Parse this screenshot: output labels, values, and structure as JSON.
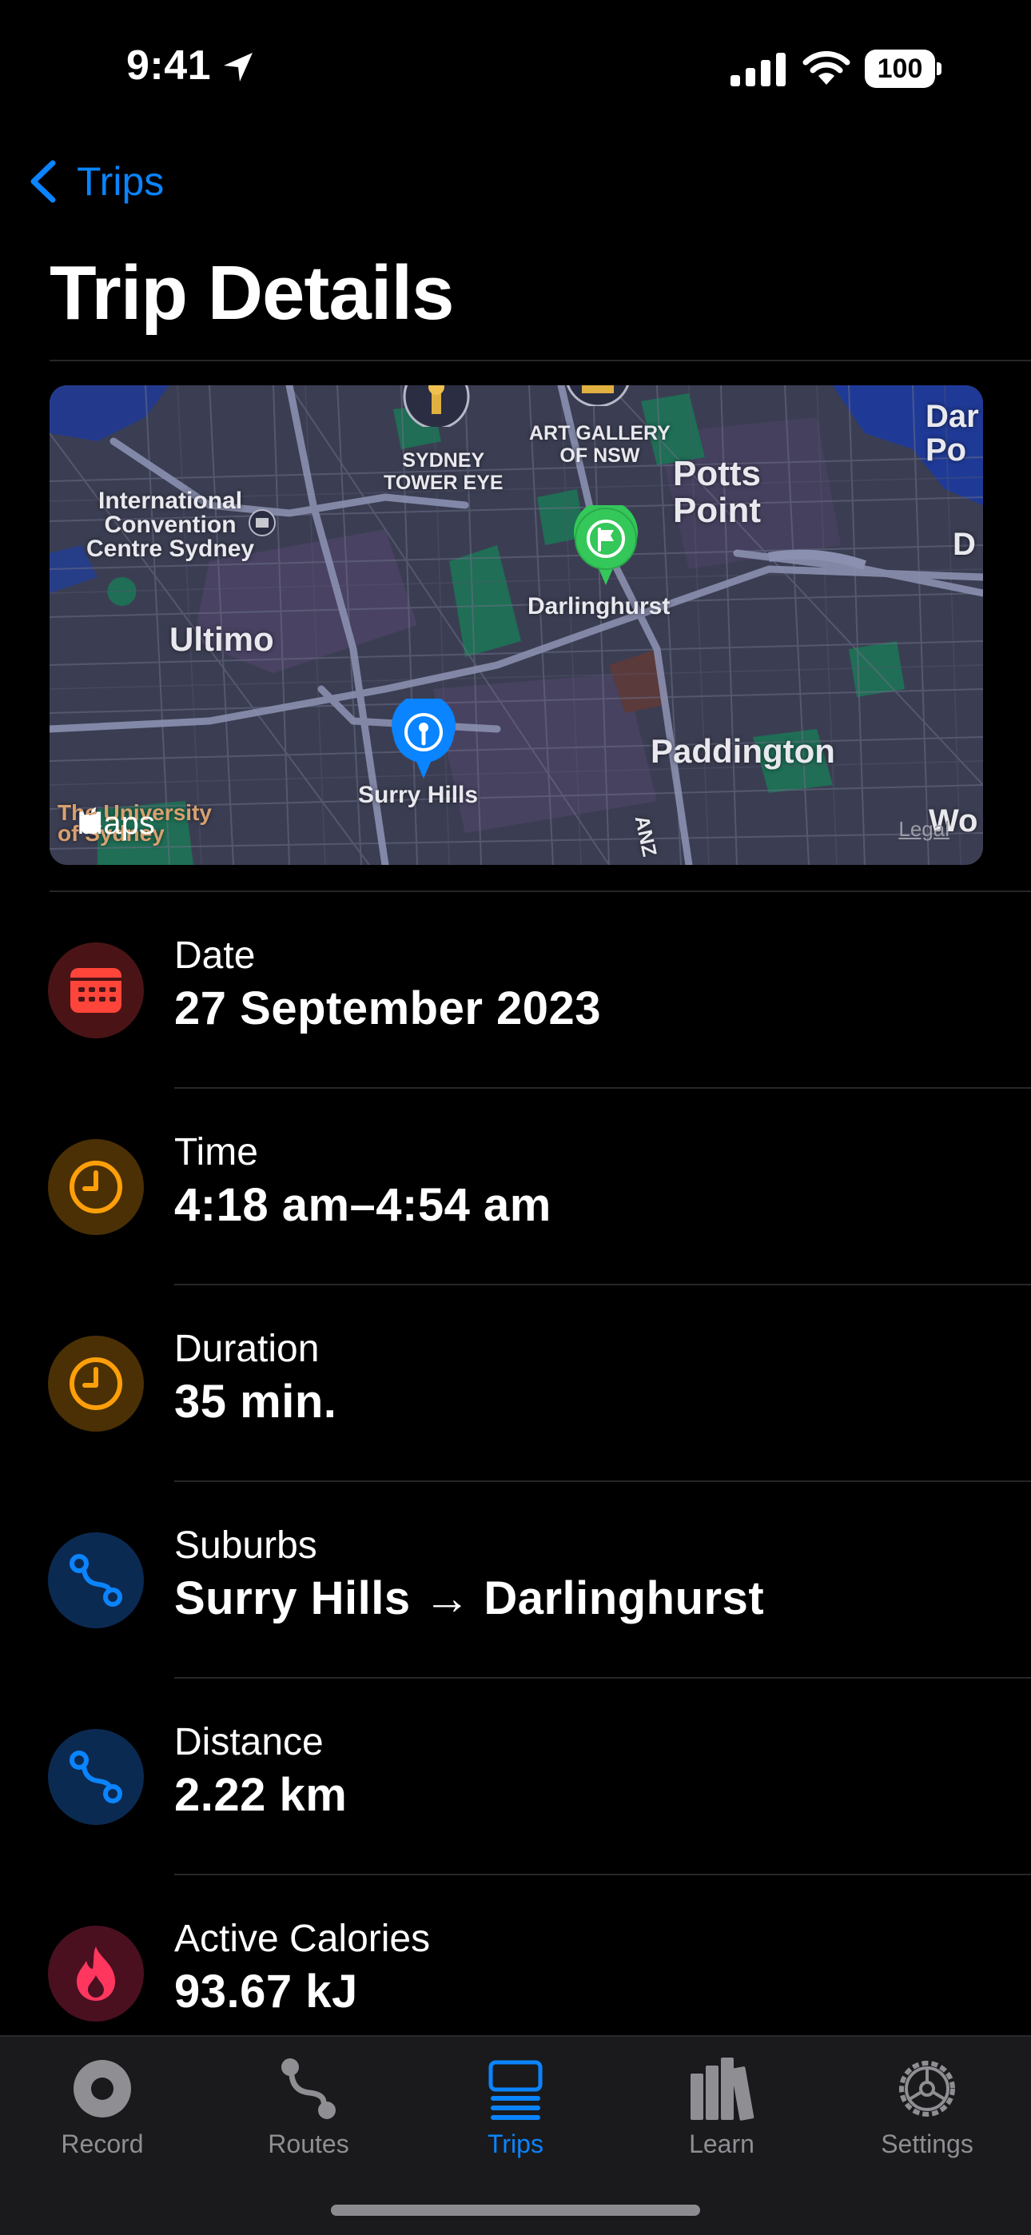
{
  "status_bar": {
    "time": "9:41",
    "battery": "100",
    "icons": [
      "location-arrow-icon",
      "cellular-signal-icon",
      "wifi-icon",
      "battery-icon"
    ]
  },
  "nav": {
    "back_label": "Trips",
    "title": "Trip Details"
  },
  "map": {
    "labels": {
      "sydney_tower_eye": "SYDNEY\nTOWER EYE",
      "art_gallery": "ART GALLERY\nOF NSW",
      "potts_point": "Potts\nPoint",
      "icc": "International\nConvention\nCentre Sydney",
      "ultimo": "Ultimo",
      "darlinghurst": "Darlinghurst",
      "surry_hills": "Surry Hills",
      "paddington": "Paddington",
      "university": "The University\nof Sydney",
      "anz": "ANZ",
      "edge_dar": "Dar\nPo",
      "edge_d": "D",
      "edge_wo": "Wo"
    },
    "brand": "Maps",
    "legal": "Legal",
    "start_pin": "start-pin-icon",
    "end_pin": "finish-flag-pin-icon"
  },
  "details": [
    {
      "label": "Date",
      "value": "27 September 2023",
      "icon": "calendar-icon",
      "icon_color": "#ff453a",
      "icon_bg": "#4a1416"
    },
    {
      "label": "Time",
      "value": "4:18 am–4:54 am",
      "icon": "clock-icon",
      "icon_color": "#ff9f0a",
      "icon_bg": "#4a3004"
    },
    {
      "label": "Duration",
      "value": "35 min.",
      "icon": "clock-icon",
      "icon_color": "#ff9f0a",
      "icon_bg": "#4a3004"
    },
    {
      "label": "Suburbs",
      "value": "Surry Hills → Darlinghurst",
      "icon": "route-icon",
      "icon_color": "#0a84ff",
      "icon_bg": "#0b2a52"
    },
    {
      "label": "Distance",
      "value": "2.22 km",
      "icon": "route-icon",
      "icon_color": "#0a84ff",
      "icon_bg": "#0b2a52"
    },
    {
      "label": "Active Calories",
      "value": "93.67 kJ",
      "icon": "flame-icon",
      "icon_color": "#ff375f",
      "icon_bg": "#4a1020"
    }
  ],
  "tab_bar": {
    "tabs": [
      {
        "label": "Record",
        "icon": "record-icon",
        "active": false
      },
      {
        "label": "Routes",
        "icon": "route-icon",
        "active": false
      },
      {
        "label": "Trips",
        "icon": "list-icon",
        "active": true
      },
      {
        "label": "Learn",
        "icon": "books-icon",
        "active": false
      },
      {
        "label": "Settings",
        "icon": "gear-icon",
        "active": false
      }
    ],
    "active_color": "#0a84ff",
    "inactive_color": "#8e8e93"
  }
}
